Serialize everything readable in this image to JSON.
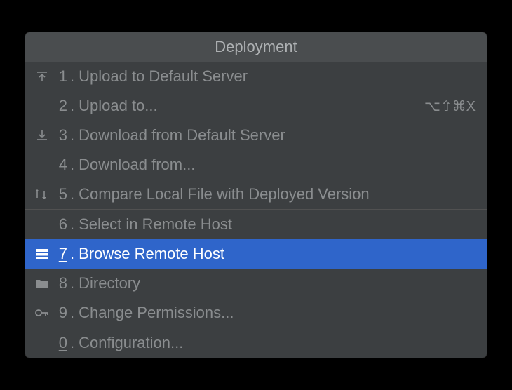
{
  "menu": {
    "title": "Deployment",
    "items": [
      {
        "icon": "upload-icon",
        "mnemonic": "1",
        "mnemonicUnderline": false,
        "label": "Upload to Default Server",
        "shortcut": "",
        "selected": false
      },
      {
        "icon": "",
        "mnemonic": "2",
        "mnemonicUnderline": false,
        "label": "Upload to...",
        "shortcut": "⌥⇧⌘X",
        "selected": false
      },
      {
        "icon": "download-icon",
        "mnemonic": "3",
        "mnemonicUnderline": false,
        "label": "Download from Default Server",
        "shortcut": "",
        "selected": false
      },
      {
        "icon": "",
        "mnemonic": "4",
        "mnemonicUnderline": false,
        "label": "Download from...",
        "shortcut": "",
        "selected": false
      },
      {
        "icon": "compare-icon",
        "mnemonic": "5",
        "mnemonicUnderline": false,
        "label": "Compare Local File with Deployed Version",
        "shortcut": "",
        "selected": false
      },
      {
        "separator": true
      },
      {
        "icon": "",
        "mnemonic": "6",
        "mnemonicUnderline": false,
        "label": "Select in Remote Host",
        "shortcut": "",
        "selected": false
      },
      {
        "icon": "remote-host-icon",
        "mnemonic": "7",
        "mnemonicUnderline": true,
        "label": "Browse Remote Host",
        "shortcut": "",
        "selected": true
      },
      {
        "icon": "folder-icon",
        "mnemonic": "8",
        "mnemonicUnderline": false,
        "label": "Directory",
        "shortcut": "",
        "selected": false
      },
      {
        "icon": "key-icon",
        "mnemonic": "9",
        "mnemonicUnderline": false,
        "label": "Change Permissions...",
        "shortcut": "",
        "selected": false
      },
      {
        "separator": true
      },
      {
        "icon": "",
        "mnemonic": "0",
        "mnemonicUnderline": true,
        "label": "Configuration...",
        "shortcut": "",
        "selected": false
      }
    ]
  },
  "colors": {
    "menuBg": "#3c3f41",
    "titleBg": "#4a4d4f",
    "text": "#8a8d8f",
    "selectedBg": "#2f65ca",
    "selectedText": "#ffffff"
  }
}
